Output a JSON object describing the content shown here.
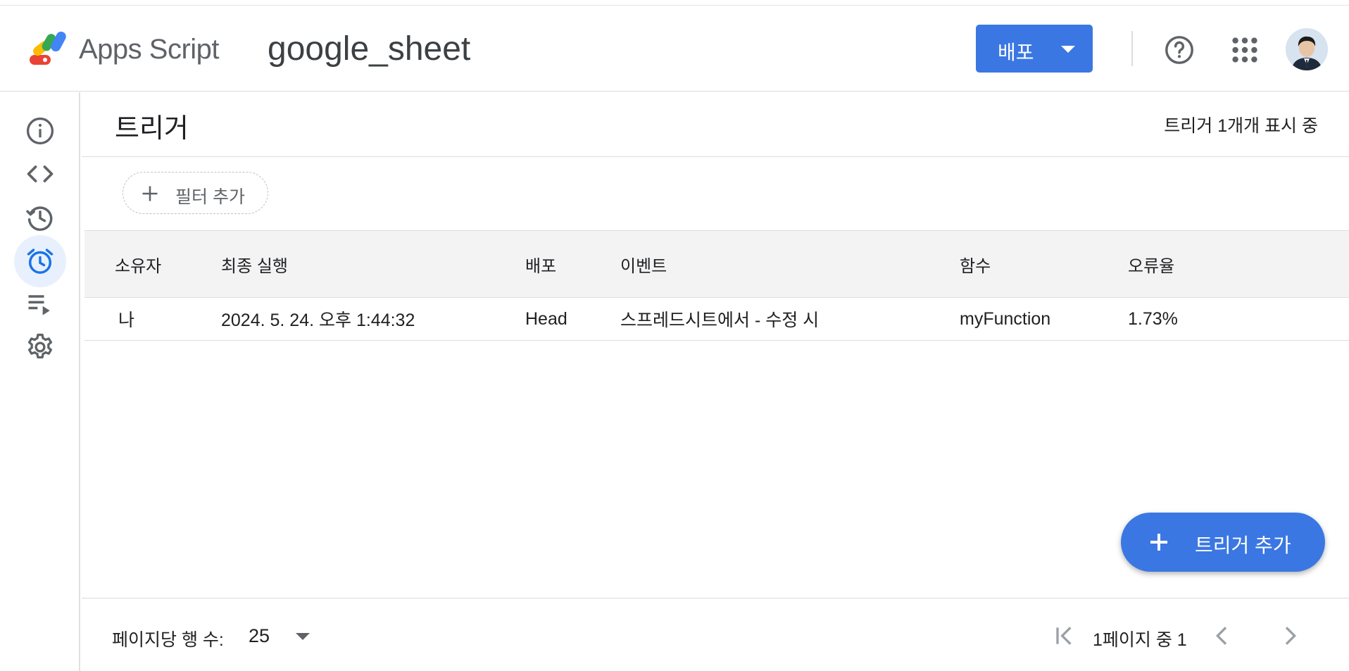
{
  "header": {
    "brand": "Apps Script",
    "project_name": "google_sheet",
    "deploy_label": "배포",
    "icons": [
      "apps-script-logo",
      "chevron-down-icon",
      "help-icon",
      "apps-grid-icon",
      "avatar"
    ]
  },
  "sidebar": {
    "items": [
      {
        "name": "overview",
        "icon": "info-icon",
        "active": false
      },
      {
        "name": "editor",
        "icon": "code-icon",
        "active": false
      },
      {
        "name": "executions-history",
        "icon": "history-icon",
        "active": false
      },
      {
        "name": "triggers",
        "icon": "alarm-clock-icon",
        "active": true
      },
      {
        "name": "executions",
        "icon": "playlist-play-icon",
        "active": false
      },
      {
        "name": "settings",
        "icon": "gear-icon",
        "active": false
      }
    ]
  },
  "main": {
    "title": "트리거",
    "count_text": "트리거 1개개 표시 중",
    "filter_label": "필터 추가",
    "table": {
      "headers": [
        "소유자",
        "최종 실행",
        "배포",
        "이벤트",
        "함수",
        "오류율"
      ],
      "rows": [
        [
          "나",
          "2024. 5. 24. 오후 1:44:32",
          "Head",
          "스프레드시트에서 - 수정 시",
          "myFunction",
          "1.73%"
        ]
      ]
    },
    "add_trigger_label": "트리거 추가"
  },
  "footer": {
    "rows_per_page_label": "페이지당 행 수:",
    "rows_per_page_value": "25",
    "page_info": "1페이지 중 1"
  },
  "colors": {
    "accent": "#3b77e3",
    "active_bg": "#e8f0fe",
    "active_icon": "#1a73e8",
    "header_bg": "#f3f3f3",
    "divider": "#dadce0"
  }
}
